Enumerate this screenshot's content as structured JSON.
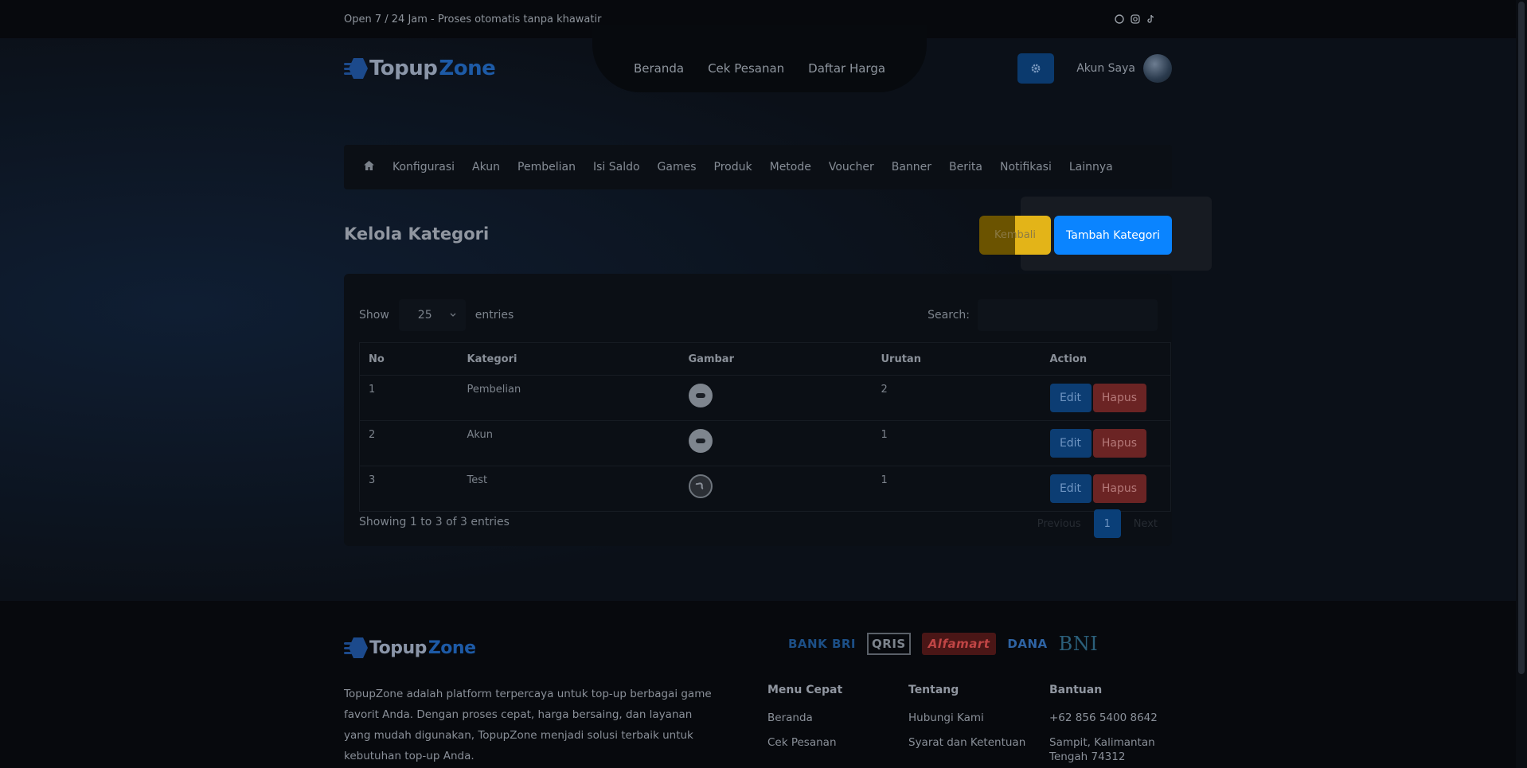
{
  "topbar": {
    "tagline": "Open 7 / 24 Jam - Proses otomatis tanpa khawatir",
    "social_icons": [
      "whatsapp-icon",
      "instagram-icon",
      "tiktok-icon"
    ]
  },
  "brand": {
    "name_part1": "Topup",
    "name_part2": "Zone"
  },
  "header": {
    "nav": [
      "Beranda",
      "Cek Pesanan",
      "Daftar Harga"
    ],
    "account_label": "Akun Saya"
  },
  "admin_nav": {
    "items": [
      "Konfigurasi",
      "Akun",
      "Pembelian",
      "Isi Saldo",
      "Games",
      "Produk",
      "Metode",
      "Voucher",
      "Banner",
      "Berita",
      "Notifikasi",
      "Lainnya"
    ]
  },
  "page": {
    "title": "Kelola Kategori",
    "back_label": "Kembali",
    "add_label": "Tambah Kategori"
  },
  "table_controls": {
    "show_label": "Show",
    "entries_value": "25",
    "entries_label": "entries",
    "search_label": "Search:"
  },
  "table": {
    "headers": [
      "No",
      "Kategori",
      "Gambar",
      "Urutan",
      "Action"
    ],
    "rows": [
      {
        "no": "1",
        "kategori": "Pembelian",
        "urutan": "2"
      },
      {
        "no": "2",
        "kategori": "Akun",
        "urutan": "1"
      },
      {
        "no": "3",
        "kategori": "Test",
        "urutan": "1"
      }
    ],
    "edit_label": "Edit",
    "delete_label": "Hapus"
  },
  "pagination": {
    "info": "Showing 1 to 3 of 3 entries",
    "previous": "Previous",
    "current": "1",
    "next": "Next"
  },
  "footer": {
    "about": "TopupZone adalah platform terpercaya untuk top-up berbagai game favorit Anda. Dengan proses cepat, harga bersaing, dan layanan yang mudah digunakan, TopupZone menjadi solusi terbaik untuk kebutuhan top-up Anda.",
    "payments": [
      "BANK BRI",
      "QRIS",
      "Alfamart",
      "DANA",
      "BNI"
    ],
    "menu_title": "Menu Cepat",
    "menu_items": [
      "Beranda",
      "Cek Pesanan"
    ],
    "about_title": "Tentang",
    "about_items": [
      "Hubungi Kami",
      "Syarat dan Ketentuan"
    ],
    "help_title": "Bantuan",
    "help_items": [
      "+62 856 5400 8642",
      "Sampit, Kalimantan Tengah 74312"
    ]
  }
}
